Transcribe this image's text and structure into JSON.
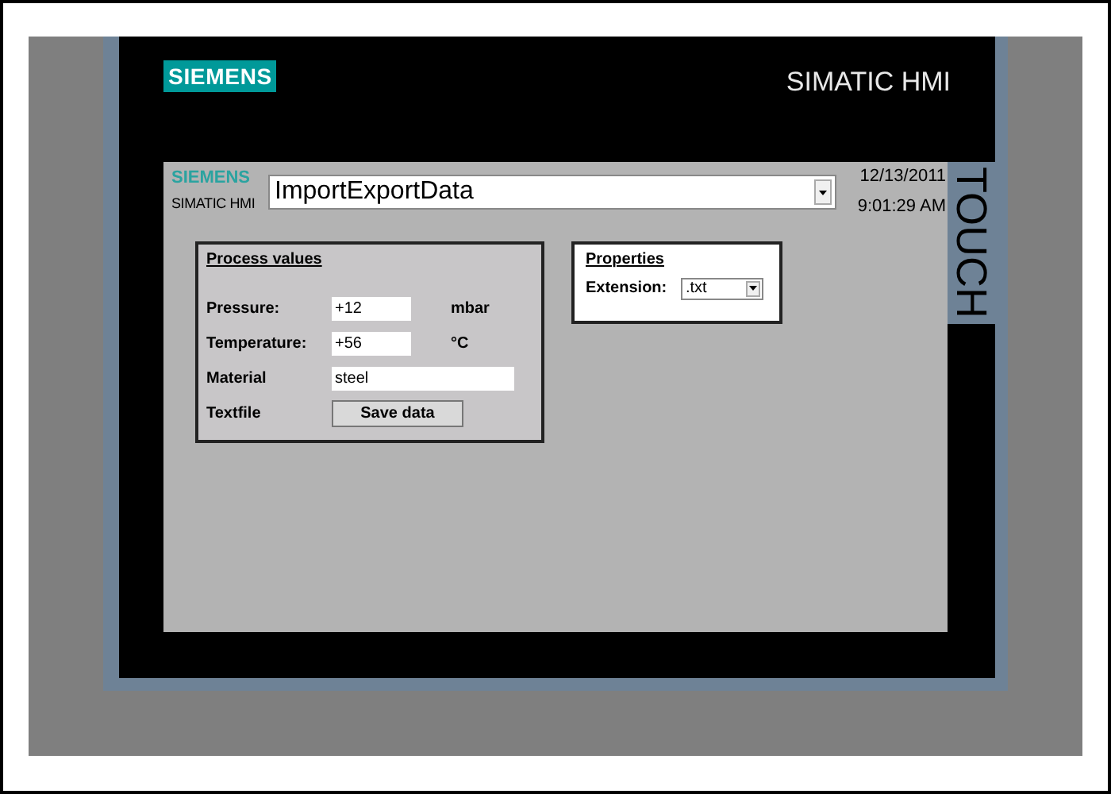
{
  "device": {
    "brand": "SIEMENS",
    "model": "SIMATIC HMI",
    "side_label": "TOUCH"
  },
  "screen": {
    "header": {
      "brand": "SIEMENS",
      "product": "SIMATIC HMI",
      "screen_selector": {
        "value": "ImportExportData"
      },
      "date": "12/13/2011",
      "time": "9:01:29 AM"
    },
    "process_values": {
      "title": "Process values",
      "rows": [
        {
          "kind": "field",
          "label": "Pressure:",
          "value": "+12",
          "unit": "mbar"
        },
        {
          "kind": "field",
          "label": "Temperature:",
          "value": "+56",
          "unit": "°C"
        },
        {
          "kind": "wide_field",
          "label": "Material",
          "value": "steel"
        },
        {
          "kind": "button",
          "label": "Textfile",
          "button": "Save data"
        }
      ]
    },
    "properties": {
      "title": "Properties",
      "extension": {
        "label": "Extension:",
        "value": ".txt"
      }
    }
  }
}
